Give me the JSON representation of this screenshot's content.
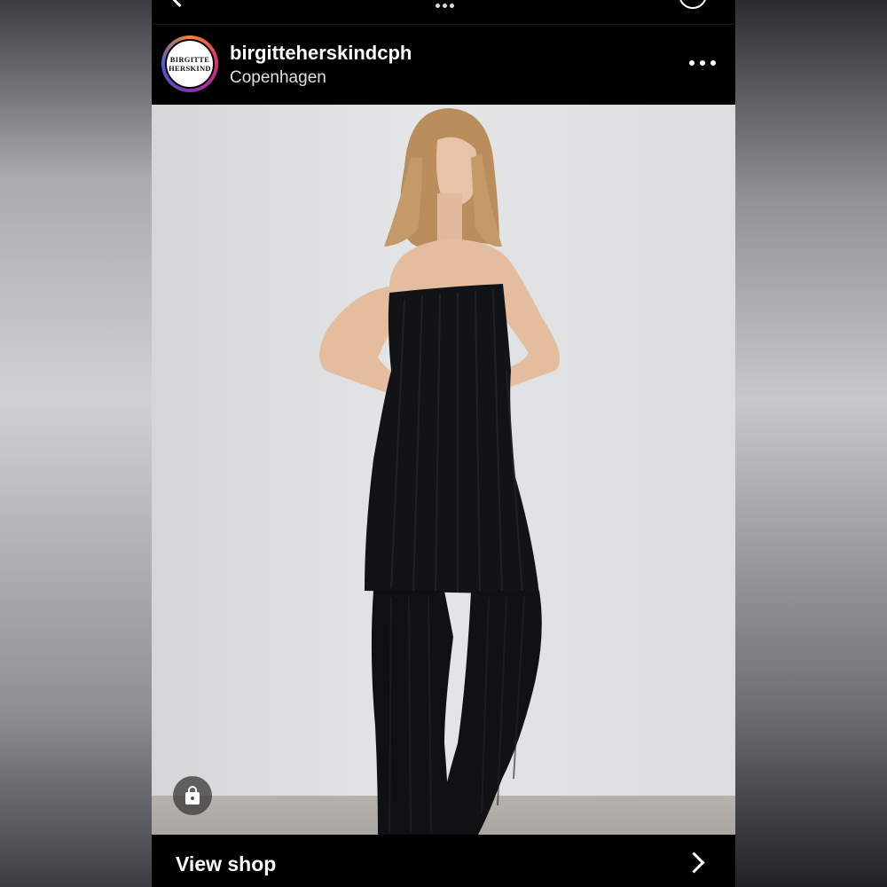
{
  "post": {
    "account": {
      "username": "birgitteherskindcph",
      "location": "Copenhagen",
      "avatar_logo_line1": "BIRGITTE",
      "avatar_logo_line2": "HERSKIND"
    },
    "image": {
      "description_icon": "fashion-photo"
    },
    "footer": {
      "view_shop_label": "View shop"
    }
  },
  "icons": {
    "back": "chevron-left-icon",
    "more": "more-options-icon",
    "shop_tag": "shopping-bag-icon",
    "view_shop_arrow": "chevron-right-icon"
  },
  "colors": {
    "background": "#000000",
    "text": "#ffffff",
    "story_ring": [
      "#f58529",
      "#dd2a7b",
      "#8134af",
      "#515bd4"
    ]
  }
}
